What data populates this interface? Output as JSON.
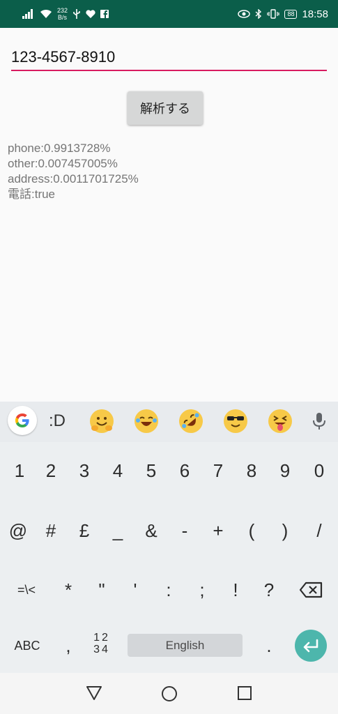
{
  "status_bar": {
    "speed_value": "232",
    "speed_unit": "B/s",
    "battery": "88",
    "time": "18:58"
  },
  "input": {
    "value": "123-4567-8910"
  },
  "analyze_button": {
    "label": "解析する"
  },
  "results": [
    "phone:0.9913728%",
    "other:0.007457005%",
    "address:0.0011701725%",
    "電話:true"
  ],
  "suggestions": {
    "text": ":D",
    "emojis": [
      "hugging-face-icon",
      "laughing-tears-icon",
      "rolling-laughing-icon",
      "sunglasses-face-icon",
      "tongue-squint-icon"
    ]
  },
  "keyboard": {
    "row1": [
      "1",
      "2",
      "3",
      "4",
      "5",
      "6",
      "7",
      "8",
      "9",
      "0"
    ],
    "row2": [
      "@",
      "#",
      "£",
      "_",
      "&",
      "-",
      "+",
      "(",
      ")",
      "/"
    ],
    "row3": [
      "=\\<",
      "*",
      "\"",
      "'",
      ":",
      ";",
      "!",
      "?"
    ],
    "abc_label": "ABC",
    "comma": ",",
    "numpad_top": "12",
    "numpad_bottom": "34",
    "space_label": "English",
    "period": "."
  },
  "colors": {
    "status_bar": "#0b5e4a",
    "accent": "#d81b60",
    "enter": "#4db6ac"
  }
}
